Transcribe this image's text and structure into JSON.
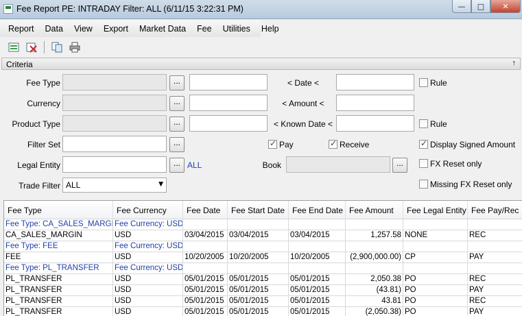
{
  "window": {
    "title": "Fee Report PE: INTRADAY Filter: ALL (6/11/15 3:22:31 PM)",
    "minimize_glyph": "—",
    "maximize_glyph": "□",
    "close_glyph": "✕"
  },
  "menu": [
    "Report",
    "Data",
    "View",
    "Export",
    "Market Data",
    "Fee",
    "Utilities",
    "Help"
  ],
  "toolbar": {
    "icons": [
      "load-report-icon",
      "clear-report-icon",
      "copy-icon",
      "print-icon"
    ]
  },
  "criteria": {
    "title": "Criteria",
    "pin_glyph": "↑",
    "fee_type_label": "Fee Type",
    "currency_label": "Currency",
    "product_type_label": "Product Type",
    "filter_set_label": "Filter Set",
    "legal_entity_label": "Legal Entity",
    "trade_filter_label": "Trade Filter",
    "date_label": "< Date <",
    "amount_label": "< Amount <",
    "known_date_label": "< Known Date <",
    "book_label": "Book",
    "ellipsis": "...",
    "all_link": "ALL",
    "trade_filter_value": "ALL",
    "trade_filter_arrow": "▼",
    "pay_label": "Pay",
    "pay_checked": true,
    "receive_label": "Receive",
    "receive_checked": true,
    "rule1_label": "Rule",
    "rule1_checked": false,
    "rule2_label": "Rule",
    "rule2_checked": false,
    "display_signed_label": "Display Signed Amount",
    "display_signed_checked": true,
    "fx_reset_label": "FX Reset only",
    "fx_reset_checked": false,
    "missing_fx_label": "Missing FX Reset only",
    "missing_fx_checked": false
  },
  "table": {
    "columns": [
      "Fee Type",
      "Fee Currency",
      "Fee Date",
      "Fee Start Date",
      "Fee End Date",
      "Fee Amount",
      "Fee Legal Entity",
      "Fee Pay/Rec"
    ],
    "rows": [
      {
        "group": true,
        "cells": [
          "Fee Type: CA_SALES_MARGIN",
          "Fee Currency: USD",
          "",
          "",
          "",
          "",
          "",
          ""
        ]
      },
      {
        "group": false,
        "cells": [
          "CA_SALES_MARGIN",
          "USD",
          "03/04/2015",
          "03/04/2015",
          "03/04/2015",
          "1,257.58",
          "NONE",
          "REC"
        ]
      },
      {
        "group": true,
        "cells": [
          "Fee Type: FEE",
          "Fee Currency: USD",
          "",
          "",
          "",
          "",
          "",
          ""
        ]
      },
      {
        "group": false,
        "cells": [
          "FEE",
          "USD",
          "10/20/2005",
          "10/20/2005",
          "10/20/2005",
          "(2,900,000.00)",
          "CP",
          "PAY"
        ]
      },
      {
        "group": true,
        "cells": [
          "Fee Type: PL_TRANSFER",
          "Fee Currency: USD",
          "",
          "",
          "",
          "",
          "",
          ""
        ]
      },
      {
        "group": false,
        "cells": [
          "PL_TRANSFER",
          "USD",
          "05/01/2015",
          "05/01/2015",
          "05/01/2015",
          "2,050.38",
          "PO",
          "REC"
        ]
      },
      {
        "group": false,
        "cells": [
          "PL_TRANSFER",
          "USD",
          "05/01/2015",
          "05/01/2015",
          "05/01/2015",
          "(43.81)",
          "PO",
          "PAY"
        ]
      },
      {
        "group": false,
        "cells": [
          "PL_TRANSFER",
          "USD",
          "05/01/2015",
          "05/01/2015",
          "05/01/2015",
          "43.81",
          "PO",
          "REC"
        ]
      },
      {
        "group": false,
        "cells": [
          "PL_TRANSFER",
          "USD",
          "05/01/2015",
          "05/01/2015",
          "05/01/2015",
          "(2,050.38)",
          "PO",
          "PAY"
        ]
      }
    ]
  }
}
